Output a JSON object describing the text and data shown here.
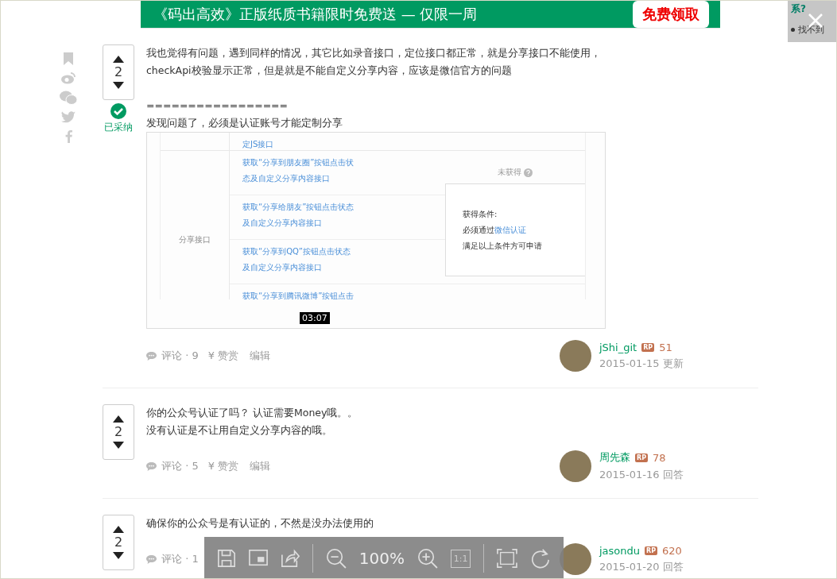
{
  "banner": {
    "text": "《码出高效》正版纸质书籍限时免费送 — 仅限一周",
    "button": "免费领取"
  },
  "side_panel": {
    "heading": "系?",
    "item": "找不到"
  },
  "answers": [
    {
      "votes": "2",
      "accepted": true,
      "accepted_label": "已采纳",
      "paragraphs": [
        "我也觉得有问题，遇到同样的情况，其它比如录音接口，定位接口都正常，就是分享接口不能使用，checkApi校验显示正常，但是就是不能自定义分享内容，应该是微信官方的问题",
        "=================",
        "发现问题了，必须是认证账号才能定制分享"
      ],
      "image": {
        "top_row": "定JS接口",
        "group": "分享接口",
        "items": [
          {
            "line1": "获取“分享到朋友圈”按钮点击状",
            "line2": "态及自定义分享内容接口"
          },
          {
            "line1": "获取“分享给朋友”按钮点击状态",
            "line2": "及自定义分享内容接口"
          },
          {
            "line1": "获取“分享到QQ”按钮点击状态",
            "line2": "及自定义分享内容接口"
          },
          {
            "line1": "获取“分享到腾讯微博”按钮点击"
          }
        ],
        "status": "未获得",
        "popup_title": "获得条件:",
        "popup_prefix": "必须通过",
        "popup_link": "微信认证",
        "popup_note": "满足以上条件方可申请",
        "timestamp": "03:07"
      },
      "comments": "评论 · 9",
      "reward_symbol": "¥",
      "reward": "赞赏",
      "edit": "编辑",
      "author": {
        "name": "jShi_git",
        "rp_badge": "RP",
        "rp": "51",
        "date": "2015-01-15 更新"
      }
    },
    {
      "votes": "2",
      "accepted": false,
      "paragraphs": [
        "你的公众号认证了吗？ 认证需要Money哦。。",
        "没有认证是不让用自定义分享内容的哦。"
      ],
      "comments": "评论 · 5",
      "reward_symbol": "¥",
      "reward": "赞赏",
      "edit": "编辑",
      "author": {
        "name": "周先森",
        "rp_badge": "RP",
        "rp": "78",
        "date": "2015-01-16 回答"
      }
    },
    {
      "votes": "2",
      "accepted": false,
      "paragraphs": [
        "确保你的公众号是有认证的，不然是没办法使用的"
      ],
      "comments": "评论 · 1",
      "author": {
        "name": "jasondu",
        "rp_badge": "RP",
        "rp": "620",
        "date": "2015-01-20 回答"
      }
    }
  ],
  "viewer_toolbar": {
    "zoom": "100%",
    "actual_size": "1:1"
  }
}
